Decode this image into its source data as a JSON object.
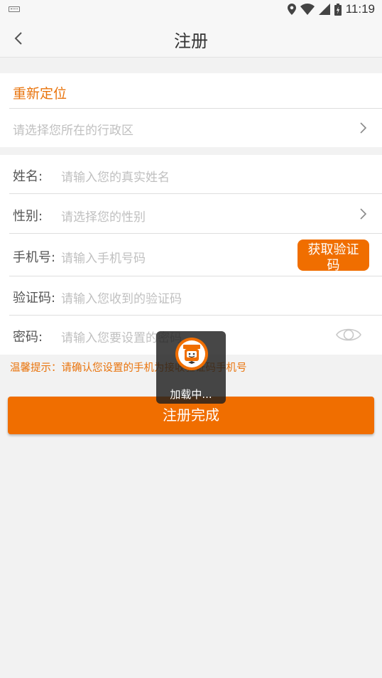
{
  "status_bar": {
    "time": "11:19"
  },
  "nav": {
    "title": "注册"
  },
  "location": {
    "title": "重新定位",
    "placeholder": "请选择您所在的行政区"
  },
  "form": {
    "name": {
      "label": "姓名:",
      "placeholder": "请输入您的真实姓名"
    },
    "gender": {
      "label": "性别:",
      "placeholder": "请选择您的性别"
    },
    "phone": {
      "label": "手机号:",
      "placeholder": "请输入手机号码",
      "button": "获取验证码"
    },
    "code": {
      "label": "验证码:",
      "placeholder": "请输入您收到的验证码"
    },
    "password": {
      "label": "密码:",
      "placeholder": "请输入您要设置的密码"
    }
  },
  "tip": "温馨提示：请确认您设置的手机为接收验证码手机号",
  "submit_label": "注册完成",
  "loading": {
    "text": "加载中..."
  },
  "colors": {
    "accent": "#f06e00",
    "accent_text": "#e9740d"
  }
}
